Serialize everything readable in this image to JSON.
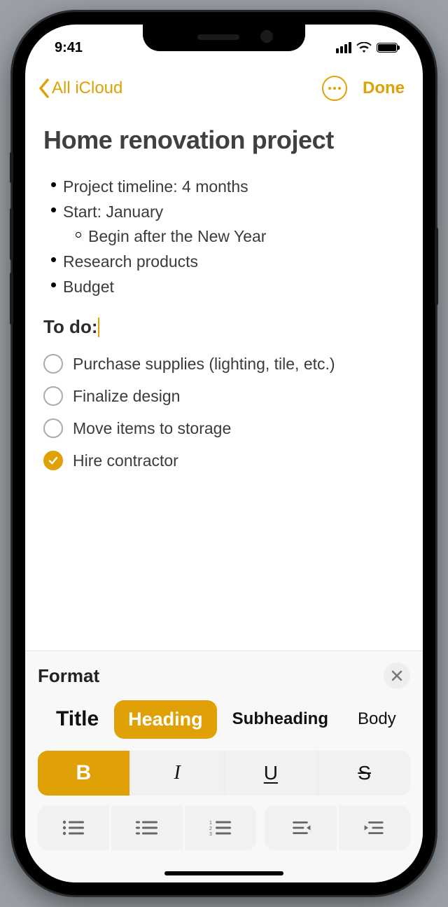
{
  "status": {
    "time": "9:41"
  },
  "nav": {
    "back_label": "All iCloud",
    "done_label": "Done"
  },
  "note": {
    "title": "Home renovation project",
    "bullets": [
      "Project timeline: 4 months",
      "Start: January",
      "Research products",
      "Budget"
    ],
    "sub_bullet": "Begin after the New Year",
    "heading": "To do:",
    "checklist": [
      {
        "label": "Purchase supplies (lighting, tile, etc.)",
        "checked": false
      },
      {
        "label": "Finalize design",
        "checked": false
      },
      {
        "label": "Move items to storage",
        "checked": false
      },
      {
        "label": "Hire contractor",
        "checked": true
      }
    ]
  },
  "format": {
    "panel_title": "Format",
    "styles": {
      "title": "Title",
      "heading": "Heading",
      "subheading": "Subheading",
      "body": "Body"
    },
    "bui": {
      "bold": "B",
      "italic": "I",
      "underline": "U",
      "strike": "S"
    }
  }
}
